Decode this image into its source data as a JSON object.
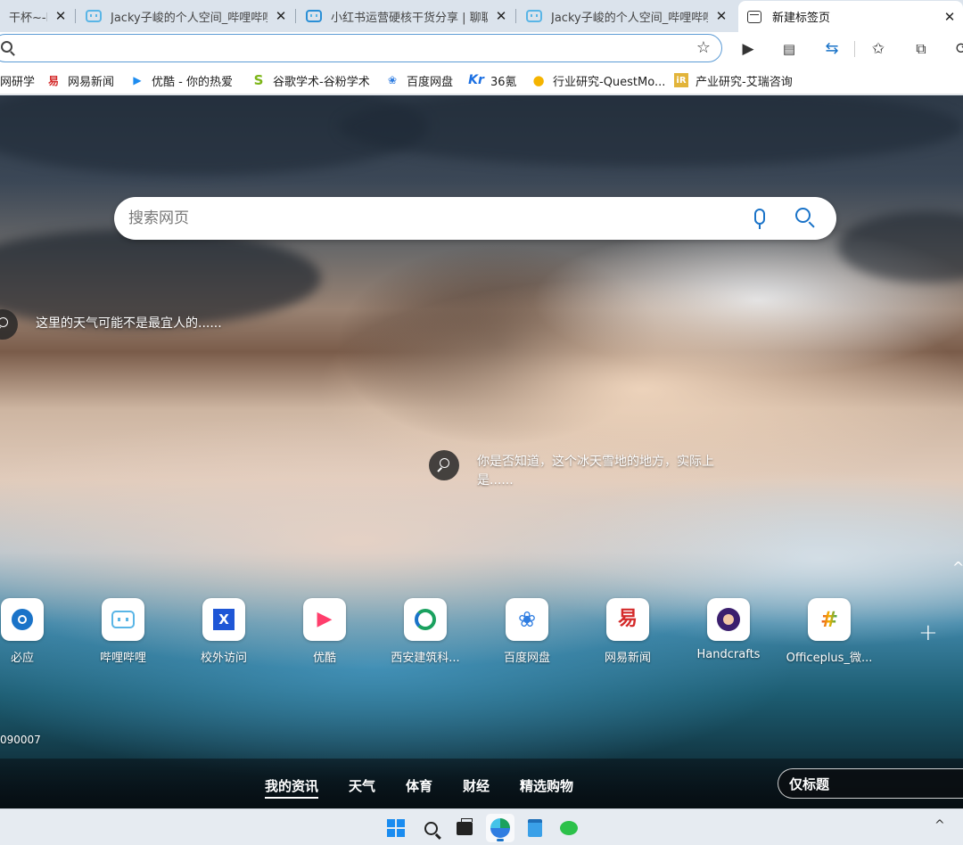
{
  "tabs": [
    {
      "title": "干杯~-bili",
      "active": false
    },
    {
      "title": "Jacky子峻的个人空间_哔哩哔哩",
      "active": false
    },
    {
      "title": "小红书运营硬核干货分享 | 聊聊",
      "active": false
    },
    {
      "title": "Jacky子峻的个人空间_哔哩哔哩",
      "active": false
    },
    {
      "title": "新建标签页",
      "active": true
    }
  ],
  "tab_close_glyph": "✕",
  "address": {
    "value": "",
    "placeholder": ""
  },
  "bookmarks": [
    {
      "label": "网研学",
      "icon": "bookmark-icon",
      "color": "#c0392b"
    },
    {
      "label": "网易新闻",
      "icon": "netease-news-icon",
      "color": "#d42a2a"
    },
    {
      "label": "优酷 - 你的热爱",
      "icon": "youku-icon",
      "color": "#1d8cf0"
    },
    {
      "label": "谷歌学术-谷粉学术",
      "icon": "scholar-icon",
      "color": "#7cb518"
    },
    {
      "label": "百度网盘",
      "icon": "baidu-netdisk-icon",
      "color": "#2f7de1"
    },
    {
      "label": "36氪",
      "icon": "36kr-icon",
      "color": "#1b6fe2"
    },
    {
      "label": "行业研究-QuestMo...",
      "icon": "questmobile-icon",
      "color": "#f5b400"
    },
    {
      "label": "产业研究-艾瑞咨询",
      "icon": "iresearch-icon",
      "color": "#e2b43a"
    }
  ],
  "search": {
    "placeholder": "搜索网页"
  },
  "hotspots": [
    {
      "text": "这里的天气可能不是最宜人的......"
    },
    {
      "text": "你是否知道，这个冰天雪地的地方，实际上是......"
    }
  ],
  "tiles": [
    {
      "label": "必应",
      "icon": "bing-icon",
      "color": "#1a73c8"
    },
    {
      "label": "哔哩哔哩",
      "icon": "bilibili-icon",
      "color": "#59b5e6"
    },
    {
      "label": "校外访问",
      "icon": "x-icon",
      "color": "#1e56d6"
    },
    {
      "label": "优酷",
      "icon": "youku-icon",
      "color": "#ff3e6c"
    },
    {
      "label": "西安建筑科...",
      "icon": "xauat-icon",
      "color": "#1aa15f"
    },
    {
      "label": "百度网盘",
      "icon": "baidu-netdisk-icon",
      "color": "#2f7de1"
    },
    {
      "label": "网易新闻",
      "icon": "netease-news-icon",
      "color": "#d42a2a"
    },
    {
      "label": "Handcrafts",
      "icon": "handcrafts-icon",
      "color": "#3b1f6e"
    },
    {
      "label": "Officeplus_微...",
      "icon": "officeplus-icon",
      "color": "#e8452c"
    }
  ],
  "code": "090007",
  "feed_tabs": [
    {
      "label": "我的资讯",
      "active": true
    },
    {
      "label": "天气",
      "active": false
    },
    {
      "label": "体育",
      "active": false
    },
    {
      "label": "财经",
      "active": false
    },
    {
      "label": "精选购物",
      "active": false
    }
  ],
  "layout_button": "仅标题",
  "taskbar": [
    "start-icon",
    "taskbar-search-icon",
    "task-view-icon",
    "edge-icon",
    "notepad-icon",
    "wechat-icon"
  ]
}
